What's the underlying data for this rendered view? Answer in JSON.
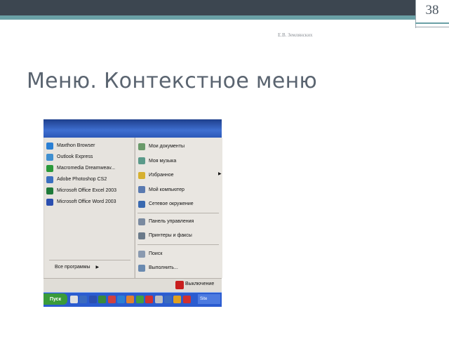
{
  "slide": {
    "number": "38",
    "author": "Е.В. Землянских",
    "title": "Меню. Контекстное меню"
  },
  "start_menu": {
    "pinned": [
      {
        "label": "Maxthon Browser",
        "icon": "globe-icon",
        "color": "#2a7fd4"
      },
      {
        "label": "Outlook Express",
        "icon": "mail-icon",
        "color": "#3f8fd0"
      },
      {
        "label": "Macromedia Dreamweav...",
        "icon": "dreamweaver-icon",
        "color": "#2a9a3a"
      },
      {
        "label": "Adobe Photoshop CS2",
        "icon": "photoshop-icon",
        "color": "#3a6fc0"
      },
      {
        "label": "Microsoft Office Excel 2003",
        "icon": "excel-icon",
        "color": "#1f7a3a"
      },
      {
        "label": "Microsoft Office Word 2003",
        "icon": "word-icon",
        "color": "#2b4fb0"
      }
    ],
    "all_programs": "Все программы",
    "places": [
      {
        "label": "Мои документы",
        "icon": "documents-icon",
        "color": "#6a9a6a"
      },
      {
        "label": "Моя музыка",
        "icon": "music-icon",
        "color": "#5a9a8a"
      },
      {
        "label": "Избранное",
        "icon": "favorites-icon",
        "color": "#d6b030"
      },
      {
        "label": "Мой компьютер",
        "icon": "computer-icon",
        "color": "#5a7ab0"
      },
      {
        "label": "Сетевое окружение",
        "icon": "network-icon",
        "color": "#3a6ab0"
      }
    ],
    "system": [
      {
        "label": "Панель управления",
        "icon": "control-panel-icon",
        "color": "#7a8aa0"
      },
      {
        "label": "Принтеры и факсы",
        "icon": "printer-icon",
        "color": "#6a7a8a"
      }
    ],
    "tools": [
      {
        "label": "Поиск",
        "icon": "search-icon",
        "color": "#8a9ab0"
      },
      {
        "label": "Выполнить...",
        "icon": "run-icon",
        "color": "#6a8ab0"
      }
    ],
    "shutdown": "Выключение",
    "taskbar": {
      "start_label": "Пуск",
      "site_label": "Site",
      "quick_icons": [
        "#e0e0e0",
        "#3a6ac0",
        "#2b4fb0",
        "#3a8a3a",
        "#d04040",
        "#2a7fd4",
        "#e08030",
        "#40a040",
        "#d03030",
        "#c0c0c0",
        "#3a6ac0",
        "#e0a020",
        "#d03030"
      ]
    }
  }
}
